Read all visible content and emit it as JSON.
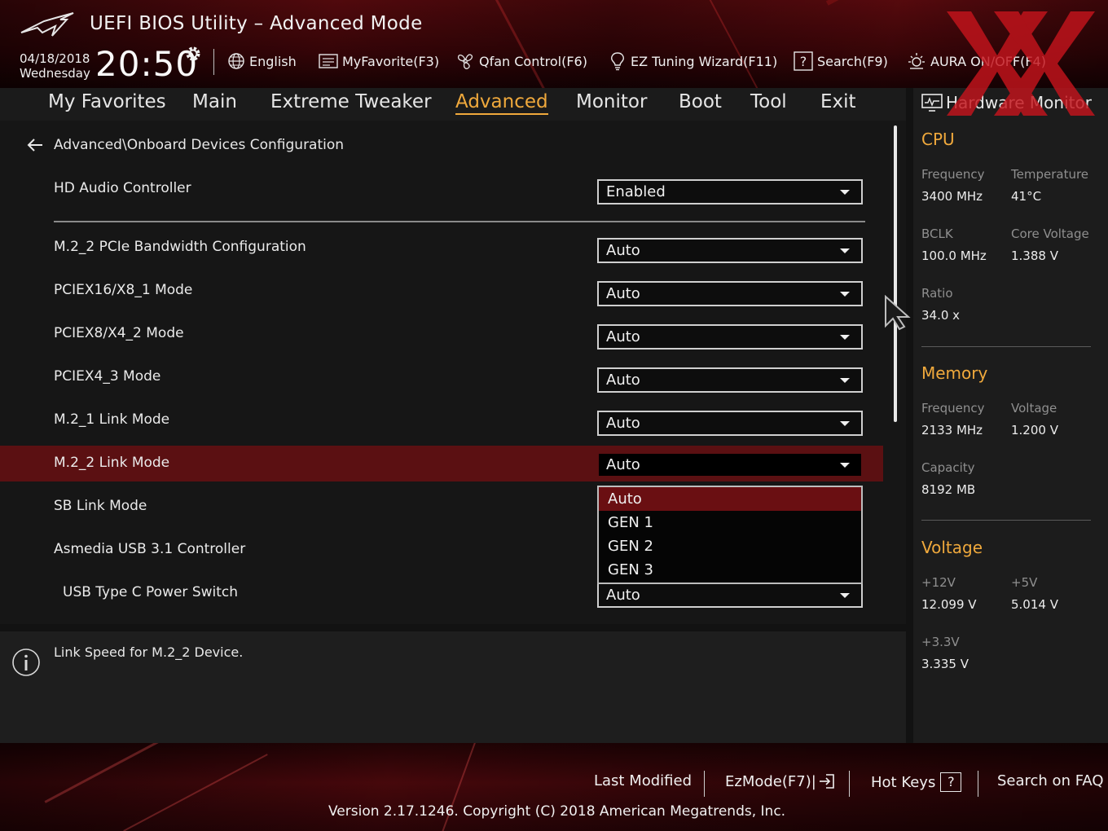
{
  "header": {
    "title": "UEFI BIOS Utility – Advanced Mode",
    "date": "04/18/2018",
    "day": "Wednesday",
    "time": "20:50",
    "tools": {
      "language": "English",
      "my_favorite": "MyFavorite(F3)",
      "qfan": "Qfan Control(F6)",
      "ez_tuning": "EZ Tuning Wizard(F11)",
      "search": "Search(F9)",
      "aura": "AURA ON/OFF(F4)"
    }
  },
  "nav": {
    "tabs": [
      "My Favorites",
      "Main",
      "Extreme Tweaker",
      "Advanced",
      "Monitor",
      "Boot",
      "Tool",
      "Exit"
    ],
    "active": "Advanced"
  },
  "breadcrumb": "Advanced\\Onboard Devices Configuration",
  "settings": [
    {
      "label": "HD Audio Controller",
      "value": "Enabled"
    },
    {
      "label": "M.2_2 PCIe Bandwidth Configuration",
      "value": "Auto"
    },
    {
      "label": "PCIEX16/X8_1 Mode",
      "value": "Auto"
    },
    {
      "label": "PCIEX8/X4_2 Mode",
      "value": "Auto"
    },
    {
      "label": "PCIEX4_3 Mode",
      "value": "Auto"
    },
    {
      "label": "M.2_1 Link Mode",
      "value": "Auto"
    },
    {
      "label": "M.2_2 Link Mode",
      "value": "Auto"
    },
    {
      "label": "SB Link Mode",
      "value": ""
    },
    {
      "label": "Asmedia USB 3.1 Controller",
      "value": ""
    },
    {
      "label": "USB Type C Power Switch",
      "value": "Auto"
    }
  ],
  "dropdown": {
    "options": [
      "Auto",
      "GEN 1",
      "GEN 2",
      "GEN 3"
    ],
    "highlighted": "Auto"
  },
  "help_text": "Link Speed for M.2_2 Device.",
  "hardware_monitor": {
    "title": "Hardware Monitor",
    "cpu": {
      "heading": "CPU",
      "frequency_label": "Frequency",
      "frequency": "3400 MHz",
      "temperature_label": "Temperature",
      "temperature": "41°C",
      "bclk_label": "BCLK",
      "bclk": "100.0 MHz",
      "core_voltage_label": "Core Voltage",
      "core_voltage": "1.388 V",
      "ratio_label": "Ratio",
      "ratio": "34.0 x"
    },
    "memory": {
      "heading": "Memory",
      "frequency_label": "Frequency",
      "frequency": "2133 MHz",
      "voltage_label": "Voltage",
      "voltage": "1.200 V",
      "capacity_label": "Capacity",
      "capacity": "8192 MB"
    },
    "voltage": {
      "heading": "Voltage",
      "v12_label": "+12V",
      "v12": "12.099 V",
      "v5_label": "+5V",
      "v5": "5.014 V",
      "v33_label": "+3.3V",
      "v33": "3.335 V"
    }
  },
  "footer": {
    "last_modified": "Last Modified",
    "ezmode": "EzMode(F7)|",
    "hot_keys": "Hot Keys",
    "hot_keys_key": "?",
    "search_faq": "Search on FAQ",
    "version": "Version 2.17.1246. Copyright (C) 2018 American Megatrends, Inc."
  },
  "colors": {
    "accent": "#f0a93c",
    "selected_row": "#5b1012",
    "brand_red": "#c4141c"
  }
}
